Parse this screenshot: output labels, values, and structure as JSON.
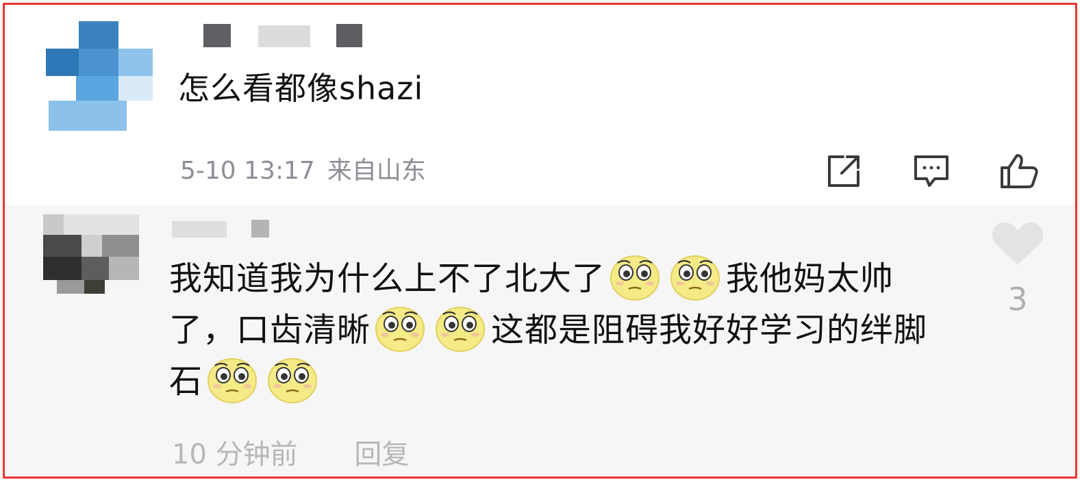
{
  "main_comment": {
    "text": "怎么看都像shazi",
    "date": "5-10 13:17",
    "location": "来自山东",
    "actions": [
      "share-icon",
      "comment-icon",
      "thumbs-up-icon"
    ]
  },
  "reply": {
    "segments": [
      {
        "text": "我知道我为什么上不了北大了"
      },
      {
        "emoji": "wide-eyed-face"
      },
      {
        "emoji": "wide-eyed-face"
      },
      {
        "text": "我他妈太帅了，口齿清晰"
      },
      {
        "emoji": "wide-eyed-face"
      },
      {
        "emoji": "wide-eyed-face"
      },
      {
        "text": "这都是阻碍我好好学习的绊脚石"
      },
      {
        "emoji": "wide-eyed-face"
      },
      {
        "emoji": "wide-eyed-face"
      }
    ],
    "time": "10 分钟前",
    "reply_label": "回复",
    "like_count": "3",
    "like_icon": "heart-icon"
  },
  "colors": {
    "frame_border": "#e8342c",
    "meta_text": "#8d8d95",
    "reply_background": "#f6f6f6",
    "reply_meta_text": "#b7b7b7",
    "emoji_face": "#f4ea86"
  }
}
